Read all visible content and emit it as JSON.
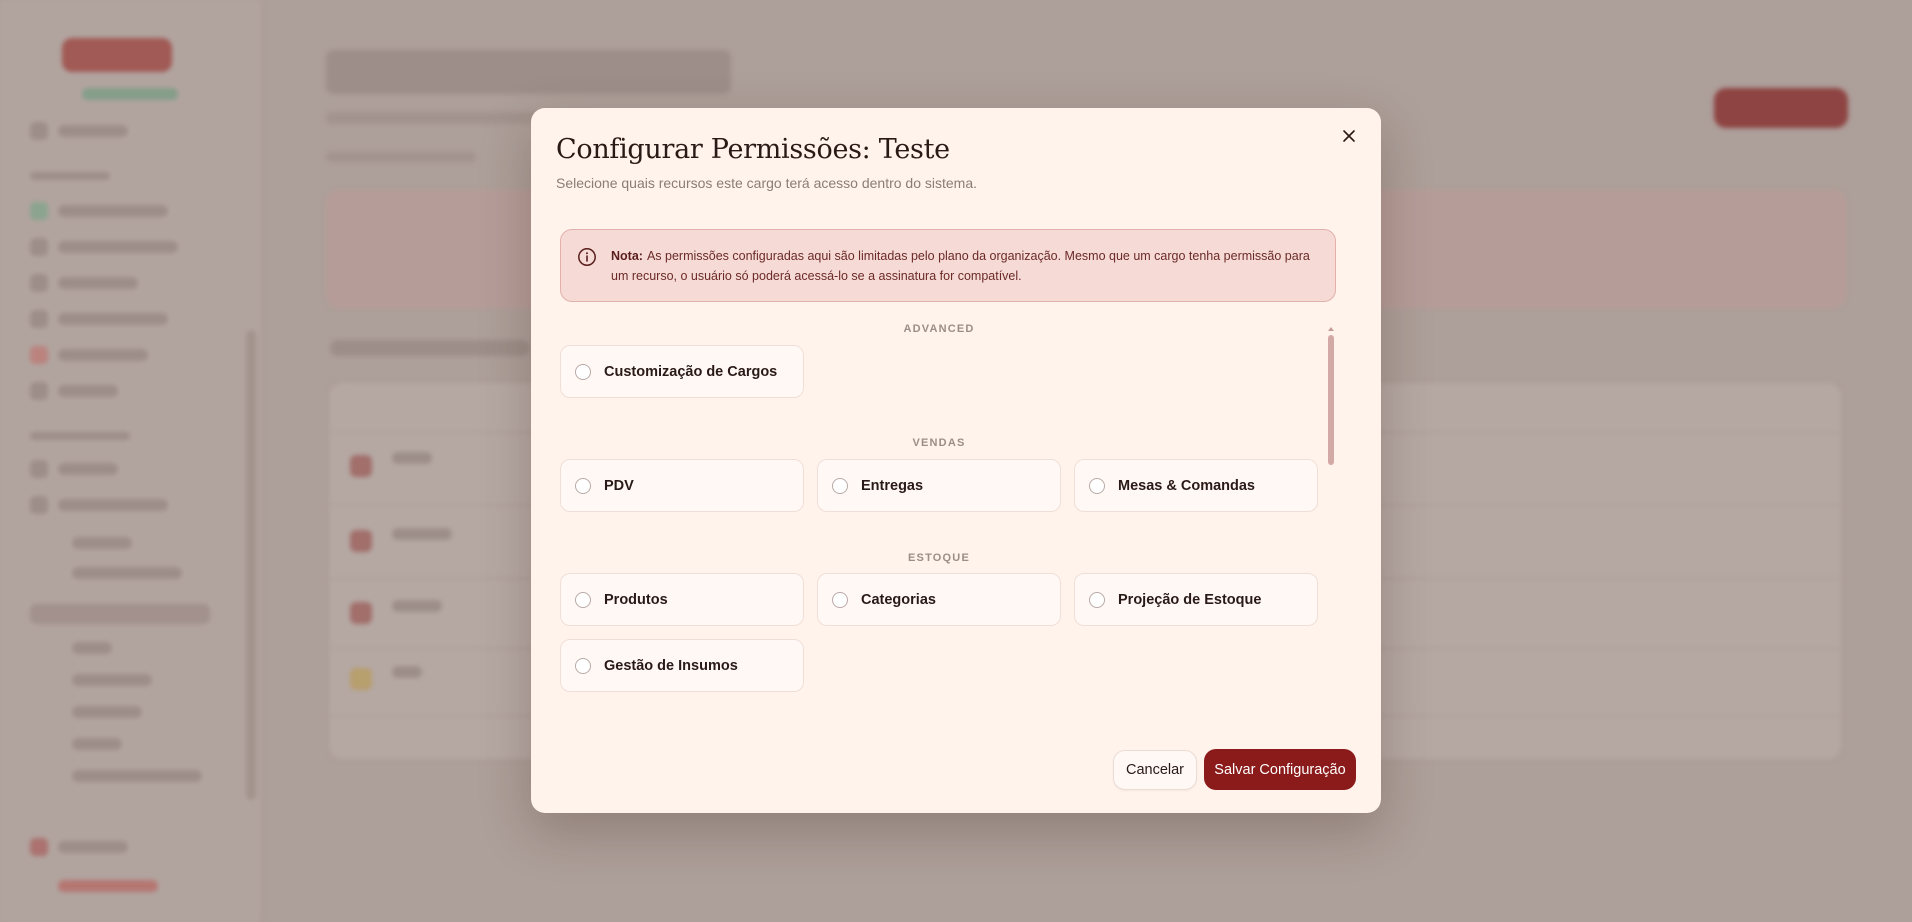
{
  "modal": {
    "title": "Configurar Permissões: Teste",
    "subtitle": "Selecione quais recursos este cargo terá acesso dentro do sistema.",
    "note_label": "Nota:",
    "note_text": "As permissões configuradas aqui são limitadas pelo plano da organização. Mesmo que um cargo tenha permissão para um recurso, o usuário só poderá acessá-lo se a assinatura for compatível.",
    "sections": [
      {
        "label": "ADVANCED",
        "items": [
          {
            "label": "Customização de Cargos",
            "checked": false
          }
        ]
      },
      {
        "label": "VENDAS",
        "items": [
          {
            "label": "PDV",
            "checked": false
          },
          {
            "label": "Entregas",
            "checked": false
          },
          {
            "label": "Mesas & Comandas",
            "checked": false
          }
        ]
      },
      {
        "label": "ESTOQUE",
        "items": [
          {
            "label": "Produtos",
            "checked": false
          },
          {
            "label": "Categorias",
            "checked": false
          },
          {
            "label": "Projeção de Estoque",
            "checked": false
          },
          {
            "label": "Gestão de Insumos",
            "checked": false
          }
        ]
      }
    ],
    "cancel_label": "Cancelar",
    "save_label": "Salvar Configuração"
  },
  "colors": {
    "accent": "#8b1a1a",
    "modal_bg": "#fff3eb",
    "note_bg": "#f5dad6",
    "note_border": "#e2b0ab"
  }
}
